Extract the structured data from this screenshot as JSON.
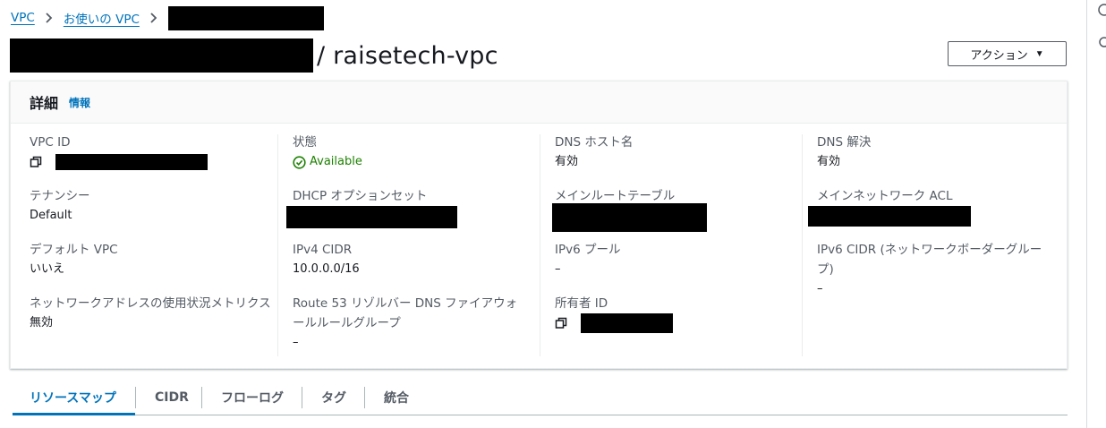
{
  "breadcrumb": {
    "items": [
      {
        "label": "VPC"
      },
      {
        "label": "お使いの VPC"
      }
    ]
  },
  "title": {
    "suffix": "/ raisetech-vpc"
  },
  "actions": {
    "label": "アクション"
  },
  "details": {
    "title": "詳細",
    "info_label": "情報",
    "fields": {
      "vpc_id": {
        "label": "VPC ID"
      },
      "state": {
        "label": "状態",
        "value": "Available"
      },
      "dns_hostnames": {
        "label": "DNS ホスト名",
        "value": "有効"
      },
      "dns_resolution": {
        "label": "DNS 解決",
        "value": "有効"
      },
      "tenancy": {
        "label": "テナンシー",
        "value": "Default"
      },
      "dhcp_options": {
        "label": "DHCP オプションセット"
      },
      "main_route_table": {
        "label": "メインルートテーブル"
      },
      "main_network_acl": {
        "label": "メインネットワーク ACL"
      },
      "default_vpc": {
        "label": "デフォルト VPC",
        "value": "いいえ"
      },
      "ipv4_cidr": {
        "label": "IPv4 CIDR",
        "value": "10.0.0.0/16"
      },
      "ipv6_pool": {
        "label": "IPv6 プール",
        "value": "–"
      },
      "ipv6_cidr": {
        "label": "IPv6 CIDR (ネットワークボーダーグループ)",
        "value": "–"
      },
      "network_address_metrics": {
        "label": "ネットワークアドレスの使用状況メトリクス",
        "value": "無効"
      },
      "route53_firewall": {
        "label": "Route 53 リゾルバー DNS ファイアウォールルールグループ",
        "value": "–"
      },
      "owner_id": {
        "label": "所有者 ID"
      }
    }
  },
  "tabs": [
    {
      "label": "リソースマップ",
      "active": true
    },
    {
      "label": "CIDR"
    },
    {
      "label": "フローログ"
    },
    {
      "label": "タグ"
    },
    {
      "label": "統合"
    }
  ],
  "colors": {
    "link": "#0073bb",
    "success": "#1d8102",
    "text": "#16191f",
    "label": "#545b64"
  },
  "icons": {
    "breadcrumb_separator": "chevron-right-icon",
    "copy": "copy-icon",
    "status": "check-circle-icon",
    "dropdown": "caret-down-icon"
  }
}
